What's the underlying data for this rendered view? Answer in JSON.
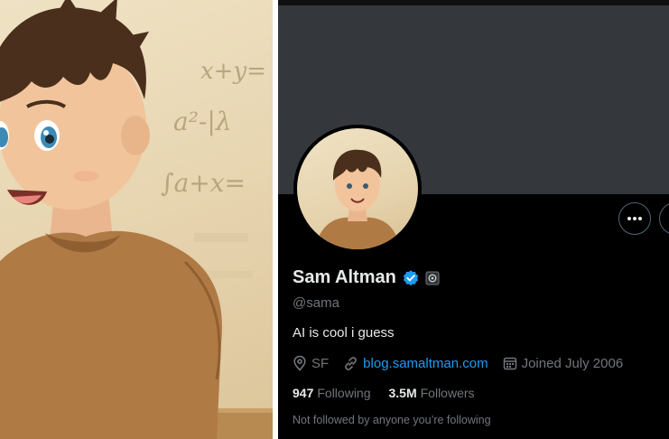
{
  "profile": {
    "name": "Sam Altman",
    "handle": "@sama",
    "bio": "AI is cool i guess",
    "location": "SF",
    "website": "blog.samaltman.com",
    "joined": "Joined July 2006",
    "following_count": "947",
    "following_label": "Following",
    "followers_count": "3.5M",
    "followers_label": "Followers",
    "not_followed_text": "Not followed by anyone you’re following"
  },
  "illustration": {
    "board_lines": [
      "x+y=",
      "a²-|λ",
      "∫a+x="
    ]
  },
  "icons": {
    "verified": "verified-badge-icon",
    "affiliate": "affiliate-badge-icon",
    "more": "more-icon",
    "location": "location-icon",
    "link": "link-icon",
    "calendar": "calendar-icon"
  },
  "colors": {
    "accent": "#1d9bf0",
    "text_primary": "#e7e9ea",
    "text_secondary": "#71767b",
    "banner": "#34373b"
  }
}
